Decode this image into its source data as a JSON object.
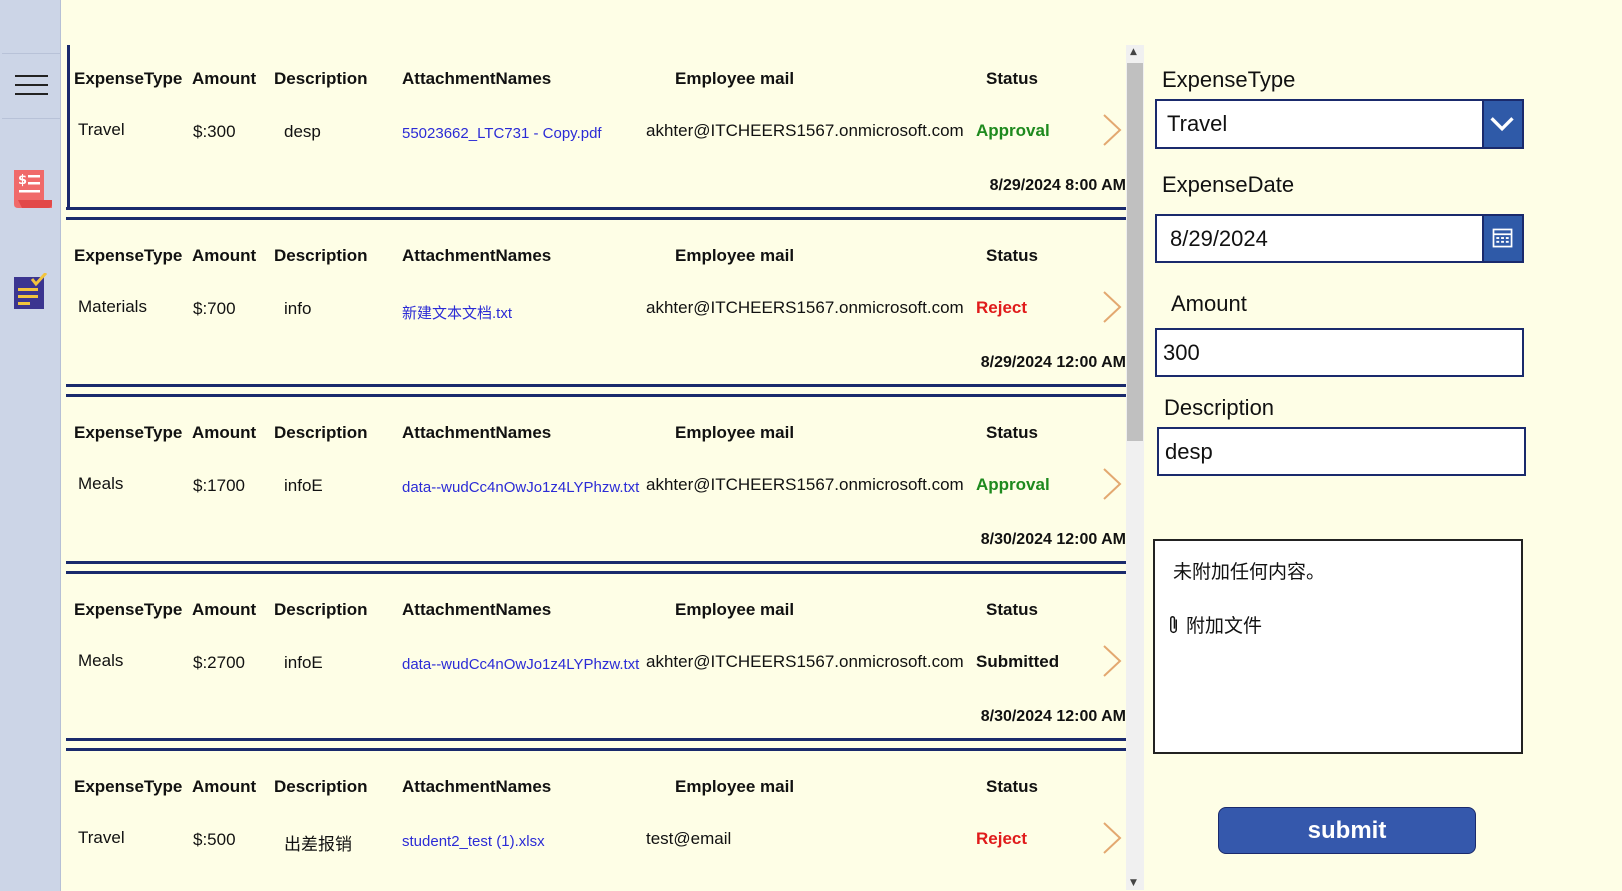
{
  "columns": {
    "type": "ExpenseType",
    "amount": "Amount",
    "description": "Description",
    "attachments": "AttachmentNames",
    "email": "Employee mail",
    "status": "Status"
  },
  "records": [
    {
      "type": "Travel",
      "amount": "$:300",
      "description": "desp",
      "attachment": "55023662_LTC731 - Copy.pdf",
      "email": "akhter@ITCHEERS1567.onmicrosoft.com",
      "status": "Approval",
      "status_color": "#1e8a1e",
      "date": "8/29/2024 8:00 AM"
    },
    {
      "type": "Materials",
      "amount": "$:700",
      "description": "info",
      "attachment": "新建文本文档.txt",
      "email": "akhter@ITCHEERS1567.onmicrosoft.com",
      "status": "Reject",
      "status_color": "#e01b1b",
      "date": "8/29/2024 12:00 AM"
    },
    {
      "type": "Meals",
      "amount": "$:1700",
      "description": "infoE",
      "attachment": "data--wudCc4nOwJo1z4LYPhzw.txt",
      "email": "akhter@ITCHEERS1567.onmicrosoft.com",
      "status": "Approval",
      "status_color": "#1e8a1e",
      "date": "8/30/2024 12:00 AM"
    },
    {
      "type": "Meals",
      "amount": "$:2700",
      "description": "infoE",
      "attachment": "data--wudCc4nOwJo1z4LYPhzw.txt",
      "email": "akhter@ITCHEERS1567.onmicrosoft.com",
      "status": "Submitted",
      "status_color": "#111111",
      "date": "8/30/2024 12:00 AM"
    },
    {
      "type": "Travel",
      "amount": "$:500",
      "description": "出差报销",
      "attachment": "student2_test (1).xlsx",
      "email": "test@email",
      "status": "Reject",
      "status_color": "#e01b1b",
      "date": ""
    }
  ],
  "form": {
    "expense_type_label": "ExpenseType",
    "expense_type_value": "Travel",
    "expense_date_label": "ExpenseDate",
    "expense_date_value": "8/29/2024",
    "amount_label": "Amount",
    "amount_value": "300",
    "description_label": "Description",
    "description_value": "desp",
    "attach_empty": "未附加任何内容。",
    "attach_add": "附加文件",
    "submit_label": "submit"
  },
  "colors": {
    "accent": "#2f5aa8",
    "navy": "#1a2a6c",
    "background": "#fefee6",
    "rail": "#ccd5e7"
  },
  "icons": [
    "menu-icon",
    "expense-receipt-icon",
    "task-checklist-icon",
    "chevron-right-icon",
    "chevron-down-icon",
    "calendar-icon",
    "paperclip-icon"
  ]
}
